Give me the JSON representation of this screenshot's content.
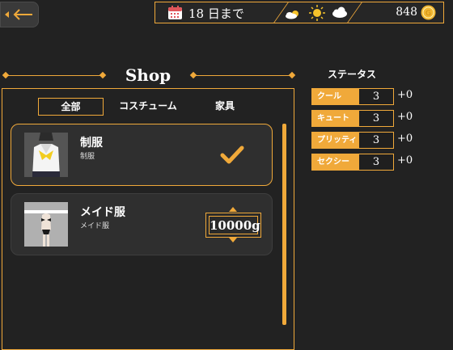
{
  "header": {
    "days_text": "18 日まで",
    "money": "848",
    "calendar_icon": "calendar-icon",
    "weather_icons": [
      "sun-cloud-icon",
      "sun-icon",
      "cloud-icon"
    ],
    "coin_icon": "coin-icon"
  },
  "shop": {
    "title": "Shop",
    "tabs": [
      {
        "label": "全部",
        "active": true
      },
      {
        "label": "コスチューム",
        "active": false
      },
      {
        "label": "家具",
        "active": false
      }
    ],
    "items": [
      {
        "name": "制服",
        "subtitle": "制服",
        "owned": true
      },
      {
        "name": "メイド服",
        "subtitle": "メイド服",
        "owned": false,
        "price": "10000g"
      }
    ]
  },
  "status": {
    "title": "ステータス",
    "stats": [
      {
        "label": "クール",
        "value": "3",
        "bonus": "+0"
      },
      {
        "label": "キュート",
        "value": "3",
        "bonus": "+0"
      },
      {
        "label": "プリッティ",
        "value": "3",
        "bonus": "+0"
      },
      {
        "label": "セクシー",
        "value": "3",
        "bonus": "+0"
      }
    ]
  },
  "colors": {
    "accent": "#f0a93a",
    "background": "#222222",
    "card": "#2f2f2f"
  }
}
